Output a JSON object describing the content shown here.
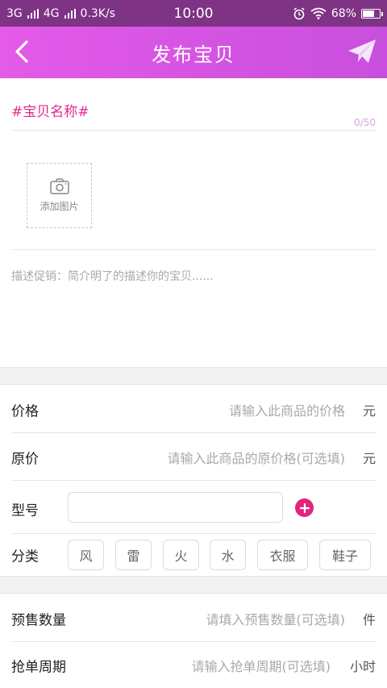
{
  "status_bar": {
    "network_left": "3G",
    "network_right": "4G",
    "speed": "0.3K/s",
    "time": "10:00",
    "battery": "68%",
    "battery_level": 0.68
  },
  "header": {
    "title": "发布宝贝"
  },
  "name": {
    "placeholder": "#宝贝名称#",
    "counter": "0/50"
  },
  "photo": {
    "label": "添加图片"
  },
  "description": {
    "placeholder": "描述促销：简介明了的描述你的宝贝......"
  },
  "price": {
    "label": "价格",
    "placeholder": "请输入此商品的价格",
    "unit": "元"
  },
  "original_price": {
    "label": "原价",
    "placeholder": "请输入此商品的原价格(可选填)",
    "unit": "元"
  },
  "model": {
    "label": "型号",
    "value": ""
  },
  "category": {
    "label": "分类",
    "options": [
      "风",
      "雷",
      "火",
      "水",
      "衣服",
      "鞋子"
    ]
  },
  "presale": {
    "label": "预售数量",
    "placeholder": "请填入预售数量(可选填)",
    "unit": "件"
  },
  "grab_period": {
    "label": "抢单周期",
    "placeholder": "请输入抢单周期(可选填)",
    "unit": "小时"
  },
  "colors": {
    "header_start": "#e45ae9",
    "header_end": "#c84fdd",
    "accent": "#e4288f",
    "status_bar": "#7e3384"
  }
}
